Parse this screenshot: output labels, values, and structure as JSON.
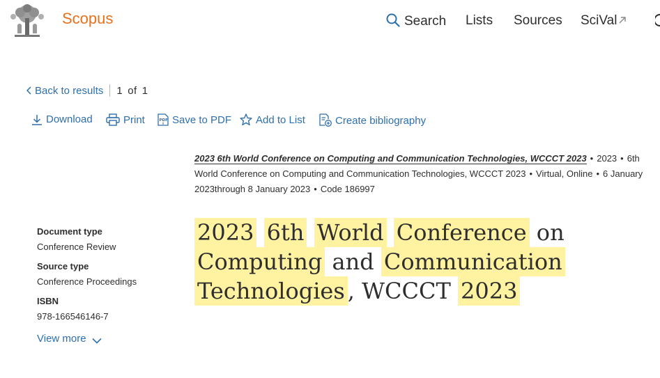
{
  "header": {
    "brand": "Scopus",
    "nav": {
      "search": "Search",
      "lists": "Lists",
      "sources": "Sources",
      "scival": "SciVal"
    }
  },
  "results_nav": {
    "back_label": "Back to results",
    "current": "1",
    "of_label": "of",
    "total": "1"
  },
  "toolbar": {
    "download": "Download",
    "print": "Print",
    "save_pdf": "Save to PDF",
    "add_list": "Add to List",
    "create_bibliography": "Create bibliography"
  },
  "source": {
    "title": "2023 6th World Conference on Computing and Communication Technologies, WCCCT 2023",
    "year": "2023",
    "conference": "6th World Conference on Computing and Communication Technologies, WCCCT 2023",
    "location": "Virtual, Online",
    "dates": "6 January 2023through 8 January 2023",
    "code": "Code 186997"
  },
  "metadata": {
    "document_type_label": "Document type",
    "document_type": "Conference Review",
    "source_type_label": "Source type",
    "source_type": "Conference Proceedings",
    "isbn_label": "ISBN",
    "isbn": "978-166546146-7",
    "view_more": "View more"
  },
  "document_title": {
    "words": [
      "2023",
      "6th",
      "World",
      "Conference",
      "on",
      "Computing",
      "and",
      "Communication",
      "Technologies",
      ",",
      "WCCCT",
      "2023"
    ],
    "highlighted": [
      true,
      true,
      true,
      true,
      false,
      true,
      false,
      true,
      true,
      false,
      false,
      true
    ]
  }
}
